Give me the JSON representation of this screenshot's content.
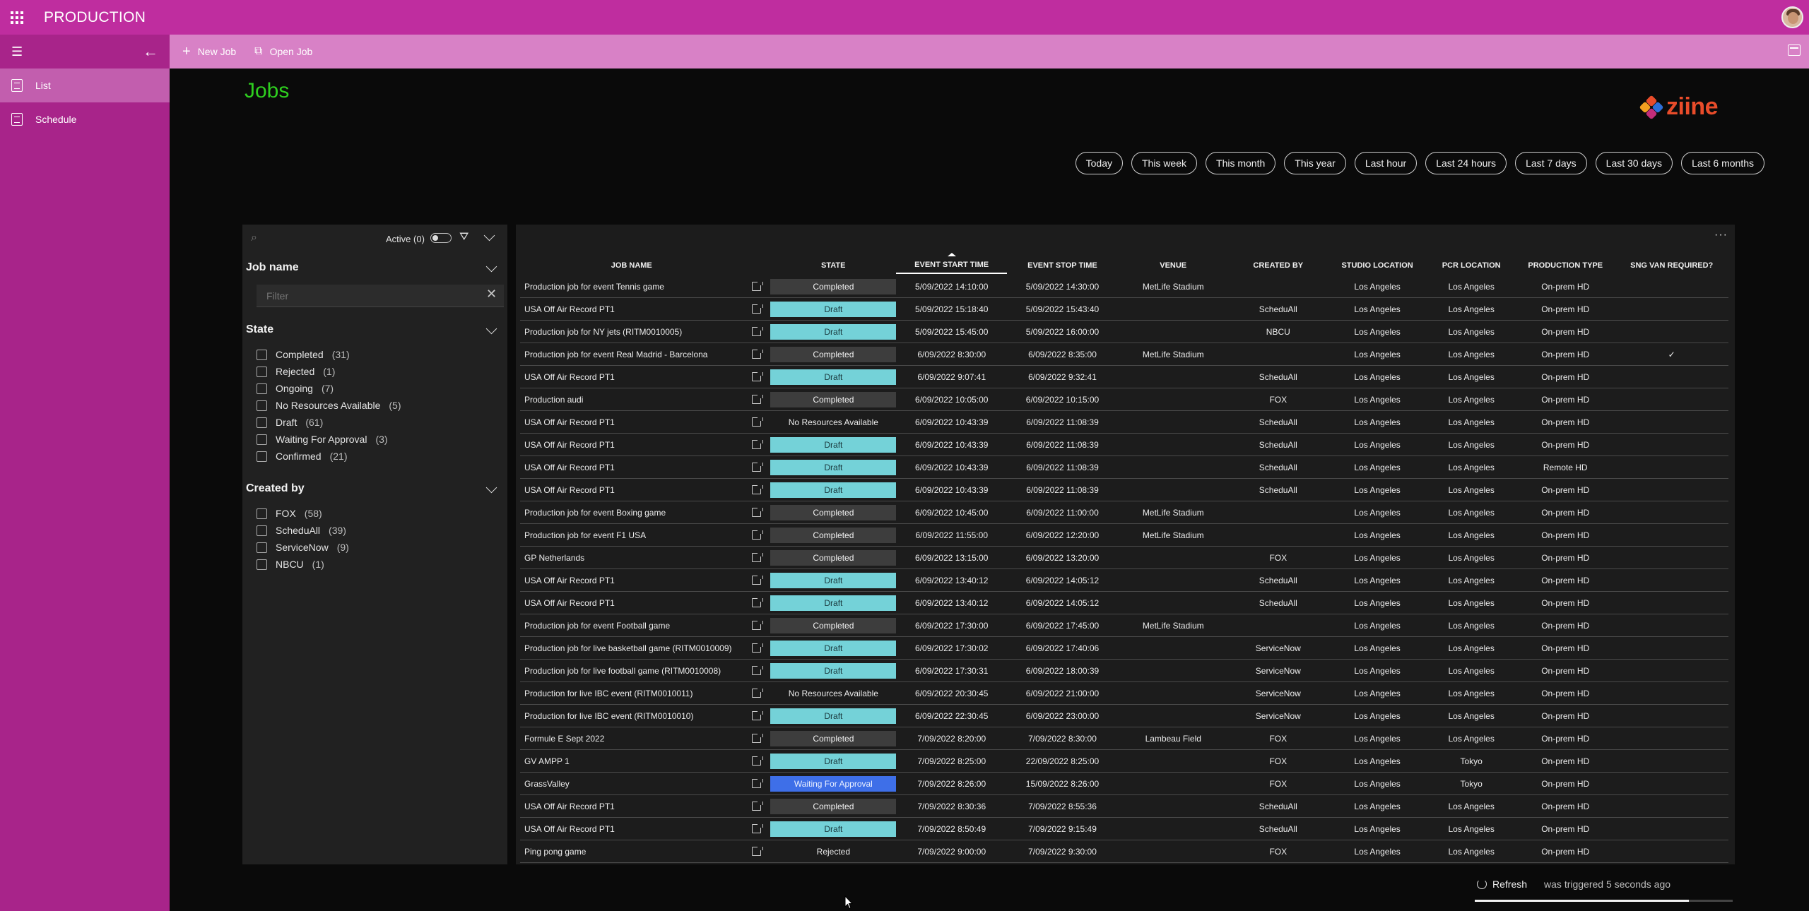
{
  "app": {
    "title": "PRODUCTION"
  },
  "command_bar": {
    "new_job": "New Job",
    "open_job": "Open Job"
  },
  "sidebar": {
    "items": [
      {
        "label": "List",
        "active": true
      },
      {
        "label": "Schedule",
        "active": false
      }
    ]
  },
  "page": {
    "title": "Jobs",
    "logo_text": "ziine"
  },
  "time_filters": [
    "Today",
    "This week",
    "This month",
    "This year",
    "Last hour",
    "Last 24 hours",
    "Last 7 days",
    "Last 30 days",
    "Last 6 months"
  ],
  "filters": {
    "active_label": "Active (0)",
    "job_name": {
      "heading": "Job name",
      "placeholder": "Filter"
    },
    "state": {
      "heading": "State",
      "options": [
        {
          "label": "Completed",
          "count": "(31)"
        },
        {
          "label": "Rejected",
          "count": "(1)"
        },
        {
          "label": "Ongoing",
          "count": "(7)"
        },
        {
          "label": "No Resources Available",
          "count": "(5)"
        },
        {
          "label": "Draft",
          "count": "(61)"
        },
        {
          "label": "Waiting For Approval",
          "count": "(3)"
        },
        {
          "label": "Confirmed",
          "count": "(21)"
        }
      ]
    },
    "created_by": {
      "heading": "Created by",
      "options": [
        {
          "label": "FOX",
          "count": "(58)"
        },
        {
          "label": "ScheduAll",
          "count": "(39)"
        },
        {
          "label": "ServiceNow",
          "count": "(9)"
        },
        {
          "label": "NBCU",
          "count": "(1)"
        }
      ]
    }
  },
  "grid": {
    "columns": [
      "JOB NAME",
      "",
      "STATE",
      "EVENT START TIME",
      "EVENT STOP TIME",
      "VENUE",
      "CREATED BY",
      "STUDIO LOCATION",
      "PCR LOCATION",
      "PRODUCTION TYPE",
      "SNG VAN REQUIRED?"
    ],
    "sorted_column": 3,
    "rows": [
      [
        "Production job for event Tennis game",
        "Completed",
        "5/09/2022 14:10:00",
        "5/09/2022 14:30:00",
        "MetLife Stadium",
        "",
        "Los Angeles",
        "Los Angeles",
        "On-prem HD",
        ""
      ],
      [
        "USA Off Air Record PT1",
        "Draft",
        "5/09/2022 15:18:40",
        "5/09/2022 15:43:40",
        "",
        "ScheduAll",
        "Los Angeles",
        "Los Angeles",
        "On-prem HD",
        ""
      ],
      [
        "Production job for NY jets (RITM0010005)",
        "Draft",
        "5/09/2022 15:45:00",
        "5/09/2022 16:00:00",
        "",
        "NBCU",
        "Los Angeles",
        "Los Angeles",
        "On-prem HD",
        ""
      ],
      [
        "Production job for event Real Madrid - Barcelona",
        "Completed",
        "6/09/2022 8:30:00",
        "6/09/2022 8:35:00",
        "MetLife Stadium",
        "",
        "Los Angeles",
        "Los Angeles",
        "On-prem HD",
        "✓"
      ],
      [
        "USA Off Air Record PT1",
        "Draft",
        "6/09/2022 9:07:41",
        "6/09/2022 9:32:41",
        "",
        "ScheduAll",
        "Los Angeles",
        "Los Angeles",
        "On-prem HD",
        ""
      ],
      [
        "Production audi",
        "Completed",
        "6/09/2022 10:05:00",
        "6/09/2022 10:15:00",
        "",
        "FOX",
        "Los Angeles",
        "Los Angeles",
        "On-prem HD",
        ""
      ],
      [
        "USA Off Air Record PT1",
        "No Resources Available",
        "6/09/2022 10:43:39",
        "6/09/2022 11:08:39",
        "",
        "ScheduAll",
        "Los Angeles",
        "Los Angeles",
        "On-prem HD",
        ""
      ],
      [
        "USA Off Air Record PT1",
        "Draft",
        "6/09/2022 10:43:39",
        "6/09/2022 11:08:39",
        "",
        "ScheduAll",
        "Los Angeles",
        "Los Angeles",
        "On-prem HD",
        ""
      ],
      [
        "USA Off Air Record PT1",
        "Draft",
        "6/09/2022 10:43:39",
        "6/09/2022 11:08:39",
        "",
        "ScheduAll",
        "Los Angeles",
        "Los Angeles",
        "Remote HD",
        ""
      ],
      [
        "USA Off Air Record PT1",
        "Draft",
        "6/09/2022 10:43:39",
        "6/09/2022 11:08:39",
        "",
        "ScheduAll",
        "Los Angeles",
        "Los Angeles",
        "On-prem HD",
        ""
      ],
      [
        "Production job for event Boxing game",
        "Completed",
        "6/09/2022 10:45:00",
        "6/09/2022 11:00:00",
        "MetLife Stadium",
        "",
        "Los Angeles",
        "Los Angeles",
        "On-prem HD",
        ""
      ],
      [
        "Production job for event F1 USA",
        "Completed",
        "6/09/2022 11:55:00",
        "6/09/2022 12:20:00",
        "MetLife Stadium",
        "",
        "Los Angeles",
        "Los Angeles",
        "On-prem HD",
        ""
      ],
      [
        "GP Netherlands",
        "Completed",
        "6/09/2022 13:15:00",
        "6/09/2022 13:20:00",
        "",
        "FOX",
        "Los Angeles",
        "Los Angeles",
        "On-prem HD",
        ""
      ],
      [
        "USA Off Air Record PT1",
        "Draft",
        "6/09/2022 13:40:12",
        "6/09/2022 14:05:12",
        "",
        "ScheduAll",
        "Los Angeles",
        "Los Angeles",
        "On-prem HD",
        ""
      ],
      [
        "USA Off Air Record PT1",
        "Draft",
        "6/09/2022 13:40:12",
        "6/09/2022 14:05:12",
        "",
        "ScheduAll",
        "Los Angeles",
        "Los Angeles",
        "On-prem HD",
        ""
      ],
      [
        "Production job for event Football game",
        "Completed",
        "6/09/2022 17:30:00",
        "6/09/2022 17:45:00",
        "MetLife Stadium",
        "",
        "Los Angeles",
        "Los Angeles",
        "On-prem HD",
        ""
      ],
      [
        "Production job for live basketball game (RITM0010009)",
        "Draft",
        "6/09/2022 17:30:02",
        "6/09/2022 17:40:06",
        "",
        "ServiceNow",
        "Los Angeles",
        "Los Angeles",
        "On-prem HD",
        ""
      ],
      [
        "Production job for live football game (RITM0010008)",
        "Draft",
        "6/09/2022 17:30:31",
        "6/09/2022 18:00:39",
        "",
        "ServiceNow",
        "Los Angeles",
        "Los Angeles",
        "On-prem HD",
        ""
      ],
      [
        "Production for live IBC event (RITM0010011)",
        "No Resources Available",
        "6/09/2022 20:30:45",
        "6/09/2022 21:00:00",
        "",
        "ServiceNow",
        "Los Angeles",
        "Los Angeles",
        "On-prem HD",
        ""
      ],
      [
        "Production for live IBC event (RITM0010010)",
        "Draft",
        "6/09/2022 22:30:45",
        "6/09/2022 23:00:00",
        "",
        "ServiceNow",
        "Los Angeles",
        "Los Angeles",
        "On-prem HD",
        ""
      ],
      [
        "Formule E Sept 2022",
        "Completed",
        "7/09/2022 8:20:00",
        "7/09/2022 8:30:00",
        "Lambeau Field",
        "FOX",
        "Los Angeles",
        "Los Angeles",
        "On-prem HD",
        ""
      ],
      [
        "GV AMPP 1",
        "Draft",
        "7/09/2022 8:25:00",
        "22/09/2022 8:25:00",
        "",
        "FOX",
        "Los Angeles",
        "Tokyo",
        "On-prem HD",
        ""
      ],
      [
        "GrassValley",
        "Waiting For Approval",
        "7/09/2022 8:26:00",
        "15/09/2022 8:26:00",
        "",
        "FOX",
        "Los Angeles",
        "Tokyo",
        "On-prem HD",
        ""
      ],
      [
        "USA Off Air Record PT1",
        "Completed",
        "7/09/2022 8:30:36",
        "7/09/2022 8:55:36",
        "",
        "ScheduAll",
        "Los Angeles",
        "Los Angeles",
        "On-prem HD",
        ""
      ],
      [
        "USA Off Air Record PT1",
        "Draft",
        "7/09/2022 8:50:49",
        "7/09/2022 9:15:49",
        "",
        "ScheduAll",
        "Los Angeles",
        "Los Angeles",
        "On-prem HD",
        ""
      ],
      [
        "Ping pong game",
        "Rejected",
        "7/09/2022 9:00:00",
        "7/09/2022 9:30:00",
        "",
        "FOX",
        "Los Angeles",
        "Los Angeles",
        "On-prem HD",
        ""
      ]
    ]
  },
  "refresh": {
    "label": "Refresh",
    "status": "was triggered 5 seconds ago",
    "progress": 0.83
  },
  "colors": {
    "header": "#bf2d9f",
    "sidebar": "#a8248a",
    "title": "#2ecf1f",
    "draft": "#74d2d8",
    "completed": "#3d3d3d",
    "approval": "#3e6fe8"
  }
}
